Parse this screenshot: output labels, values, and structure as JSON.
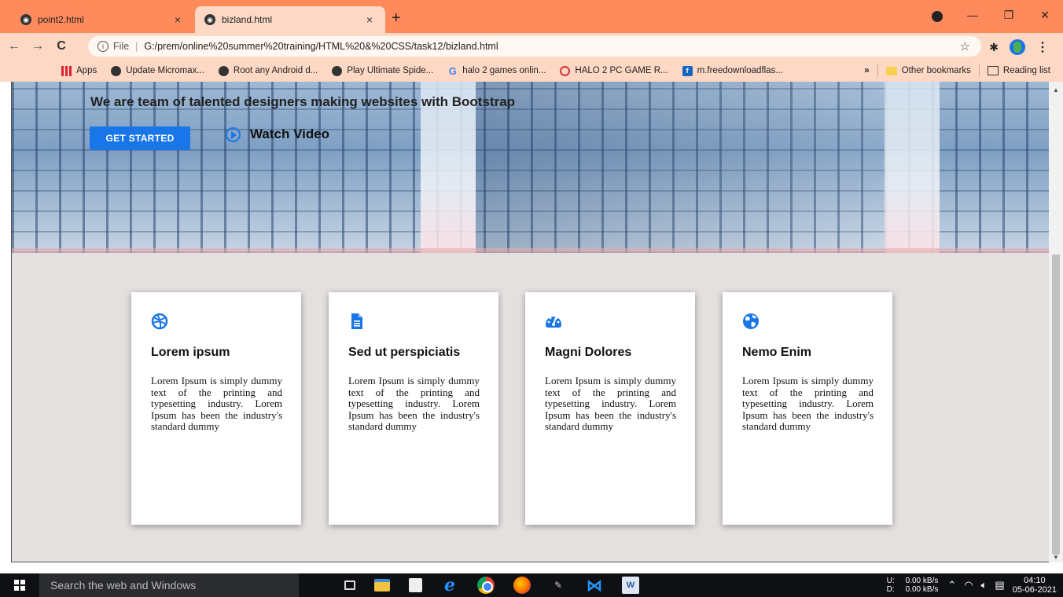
{
  "browser": {
    "tabs": [
      {
        "title": "point2.html",
        "active": false
      },
      {
        "title": "bizland.html",
        "active": true
      }
    ],
    "new_tab_symbol": "+",
    "close_symbol": "×",
    "address": {
      "scheme": "File",
      "url": "G:/prem/online%20summer%20training/HTML%20&%20CSS/task12/bizland.html"
    },
    "bookmarks": [
      {
        "label": "Apps",
        "icon": "apps-grid-icon"
      },
      {
        "label": "Update Micromax...",
        "icon": "globe-icon"
      },
      {
        "label": "Root any Android d...",
        "icon": "globe-icon"
      },
      {
        "label": "Play Ultimate Spide...",
        "icon": "globe-icon"
      },
      {
        "label": "halo 2 games onlin...",
        "icon": "google-icon"
      },
      {
        "label": "HALO 2 PC GAME R...",
        "icon": "blocked-icon"
      },
      {
        "label": "m.freedownloadflas...",
        "icon": "f-favicon"
      }
    ],
    "bookmarks_overflow": "»",
    "other_bookmarks": "Other bookmarks",
    "reading_list": "Reading list"
  },
  "page": {
    "hero": {
      "subtitle": "We are team of talented designers making websites with Bootstrap",
      "cta_label": "GET STARTED",
      "watch_label": "Watch Video"
    },
    "cards": [
      {
        "icon": "dribbble-icon",
        "title": "Lorem ipsum",
        "text": "Lorem Ipsum is simply dummy text of the printing and typesetting industry. Lorem Ipsum has been the industry's standard dummy"
      },
      {
        "icon": "document-icon",
        "title": "Sed ut perspiciatis",
        "text": "Lorem Ipsum is simply dummy text of the printing and typesetting industry. Lorem Ipsum has been the industry's standard dummy"
      },
      {
        "icon": "speedometer-icon",
        "title": "Magni Dolores",
        "text": "Lorem Ipsum is simply dummy text of the printing and typesetting industry. Lorem Ipsum has been the industry's standard dummy"
      },
      {
        "icon": "globe-icon",
        "title": "Nemo Enim",
        "text": "Lorem Ipsum is simply dummy text of the printing and typesetting industry. Lorem Ipsum has been the industry's standard dummy"
      }
    ],
    "accent_color": "#1976e8"
  },
  "taskbar": {
    "search_placeholder": "Search the web and Windows",
    "net_up_label": "U:",
    "net_down_label": "D:",
    "net_up_value": "0.00 kB/s",
    "net_down_value": "0.00 kB/s",
    "time": "04:10",
    "date": "05-06-2021"
  }
}
